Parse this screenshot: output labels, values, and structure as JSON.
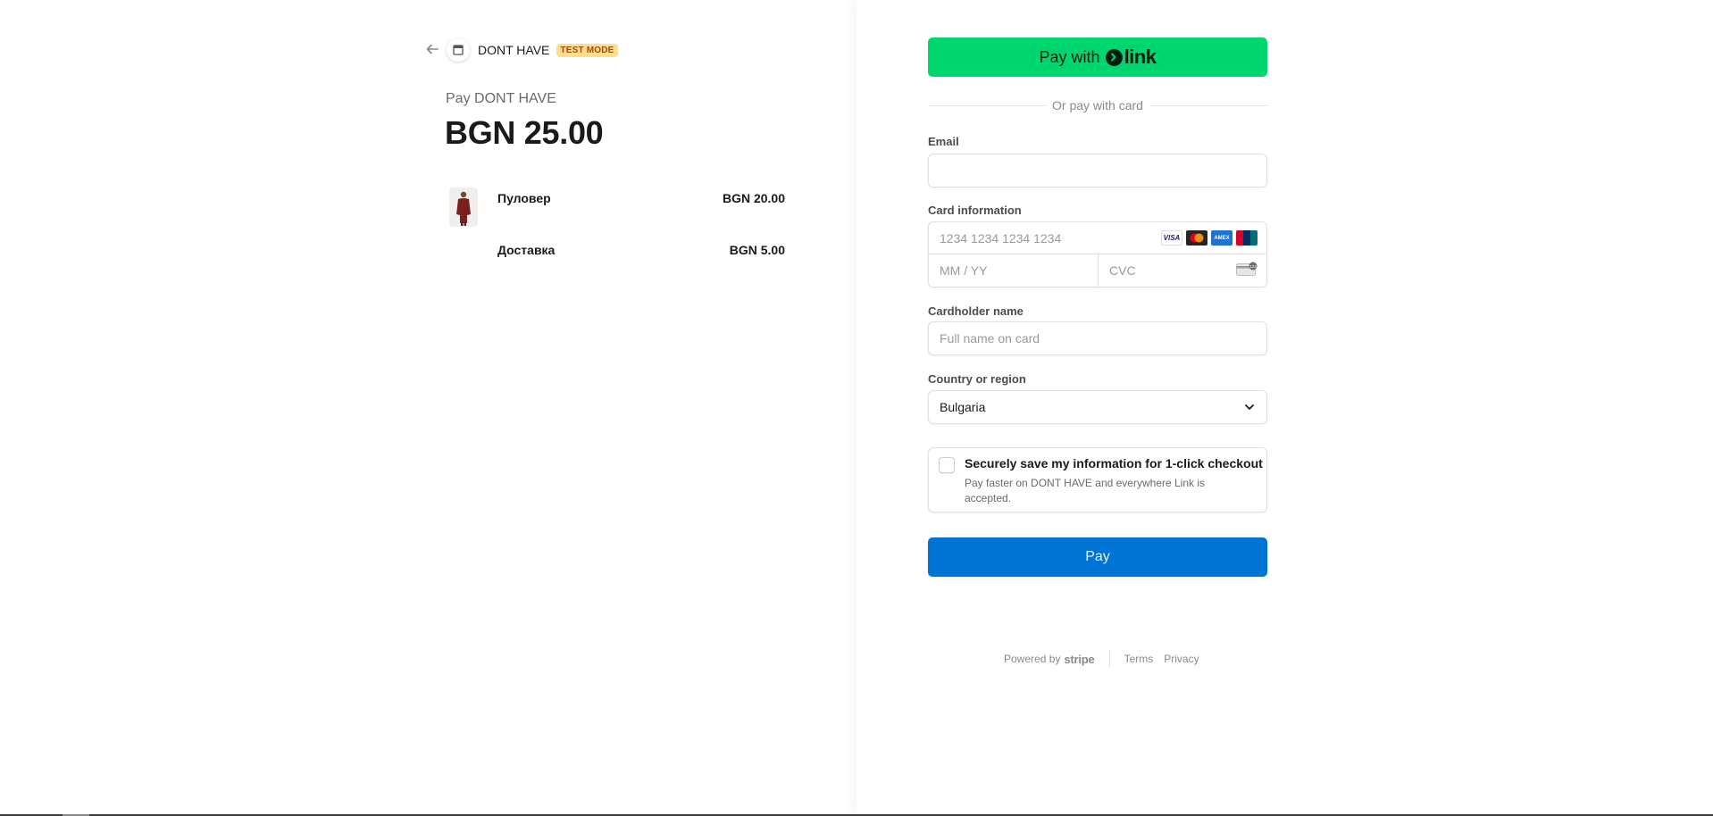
{
  "header": {
    "store_name": "DONT HAVE",
    "badge": "TEST MODE"
  },
  "summary": {
    "pay_label": "Pay DONT HAVE",
    "total": "BGN 25.00",
    "items": [
      {
        "name": "Пуловер",
        "price": "BGN 20.00"
      },
      {
        "name": "Доставка",
        "price": "BGN 5.00"
      }
    ]
  },
  "form": {
    "link_button": {
      "prefix": "Pay with",
      "brand": "link"
    },
    "divider": "Or pay with card",
    "email": {
      "label": "Email",
      "value": "",
      "placeholder": ""
    },
    "card": {
      "label": "Card information",
      "number_placeholder": "1234 1234 1234 1234",
      "expiry_placeholder": "MM / YY",
      "cvc_placeholder": "CVC",
      "brands": [
        "VISA",
        "mastercard",
        "AMEX",
        "UnionPay"
      ]
    },
    "cardholder": {
      "label": "Cardholder name",
      "placeholder": "Full name on card"
    },
    "country": {
      "label": "Country or region",
      "value": "Bulgaria"
    },
    "save": {
      "checked": false,
      "title": "Securely save my information for 1-click checkout",
      "description": "Pay faster on DONT HAVE and everywhere Link is accepted."
    },
    "pay_button": "Pay"
  },
  "footer": {
    "powered_by": "Powered by",
    "stripe": "stripe",
    "terms": "Terms",
    "privacy": "Privacy"
  },
  "colors": {
    "link_green": "#00d66f",
    "pay_blue": "#0074d4",
    "badge_bg": "#ffde92",
    "badge_text": "#a04c00"
  }
}
